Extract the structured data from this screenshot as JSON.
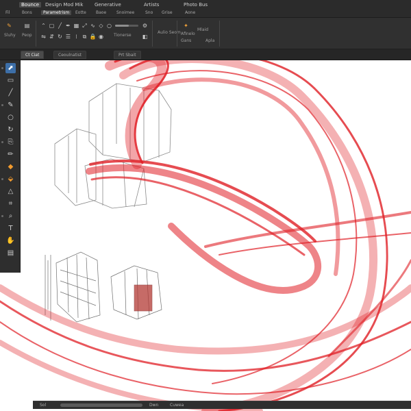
{
  "menubar": {
    "items": [
      {
        "label": "Bounce",
        "active": true
      },
      {
        "label": "Design Mod Mik"
      },
      {
        "label": "Generative"
      },
      {
        "label": "Artists"
      },
      {
        "label": "Photo Bus"
      }
    ],
    "subitems": [
      "Fil",
      "Bons",
      "Parametrism",
      "Eotte",
      "Baoe",
      "Snoimee",
      "Sno",
      "Grise",
      "Aone"
    ]
  },
  "ribbon": {
    "labels": [
      "Sluhy",
      "Peop",
      "Tionerse",
      "Aulio Seom",
      "Afinelo",
      "Gans",
      "Mlaid",
      "Apla"
    ]
  },
  "docbar": {
    "tabs": [
      {
        "label": "Ct Ciat",
        "active": true
      },
      {
        "label": "Ceoulnatist"
      },
      {
        "label": "Prt Sbait"
      }
    ]
  },
  "statusbar": {
    "items": [
      "Sol",
      "Dwn",
      "Cuwea"
    ]
  },
  "colors": {
    "chrome": "#2b2b2b",
    "accent_red": "#e01f26",
    "selected_tool": "#3d6fa8",
    "tool_orange": "#f39b2e"
  },
  "icons": [
    "move-tool-icon",
    "rectangle-tool-icon",
    "pen-tool-icon",
    "brush-tool-icon",
    "ellipse-tool-icon",
    "rotate-tool-icon",
    "stamp-tool-icon",
    "pencil-tool-icon",
    "paint-bucket-icon",
    "eyedropper-icon",
    "select-tool-icon",
    "crop-tool-icon",
    "zoom-tool-icon",
    "text-tool-icon",
    "hand-tool-icon"
  ]
}
